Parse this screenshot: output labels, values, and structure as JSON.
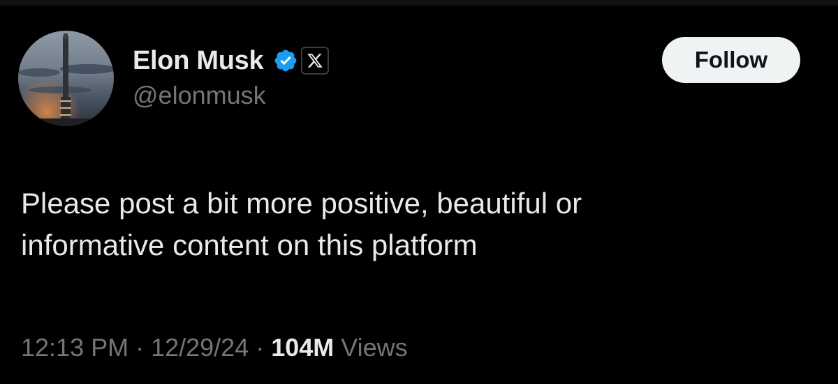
{
  "author": {
    "display_name": "Elon Musk",
    "handle": "@elonmusk",
    "verified_icon": "verified-badge-icon",
    "affiliate_icon": "x-logo-icon"
  },
  "follow_button": {
    "label": "Follow"
  },
  "tweet": {
    "lines": [
      "Please post a bit more positive, beautiful or",
      "informative content on this platform"
    ]
  },
  "meta": {
    "time": "12:13 PM",
    "date": "12/29/24",
    "separator": "·",
    "views_count": "104M",
    "views_label": "Views"
  },
  "colors": {
    "background": "#000000",
    "primary_text": "#e7e9ea",
    "secondary_text": "#71767b",
    "verified_blue": "#1d9bf0",
    "follow_bg": "#eff3f4"
  }
}
